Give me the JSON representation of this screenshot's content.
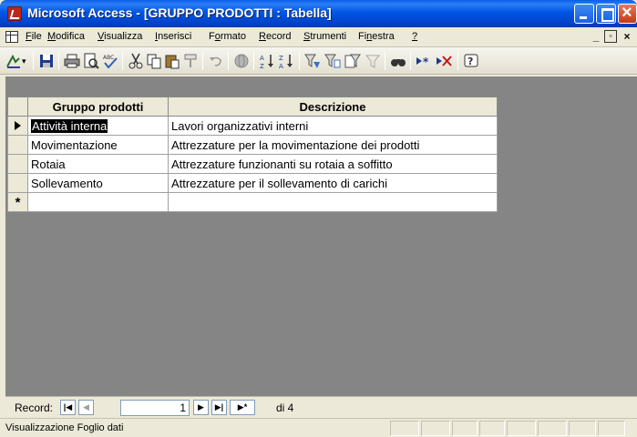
{
  "window": {
    "title": "Microsoft Access - [GRUPPO PRODOTTI : Tabella]"
  },
  "menu": {
    "items": [
      {
        "label": "File",
        "accel": "F"
      },
      {
        "label": "Modifica",
        "accel": "M"
      },
      {
        "label": "Visualizza",
        "accel": "V"
      },
      {
        "label": "Inserisci",
        "accel": "I"
      },
      {
        "label": "Formato",
        "accel": "o"
      },
      {
        "label": "Record",
        "accel": "R"
      },
      {
        "label": "Strumenti",
        "accel": "S"
      },
      {
        "label": "Finestra",
        "accel": "n"
      },
      {
        "label": "?",
        "accel": "?"
      }
    ]
  },
  "toolbar": {
    "icons": [
      "view-design-icon",
      "save-icon",
      "print-icon",
      "print-preview-icon",
      "spelling-icon",
      "cut-icon",
      "copy-icon",
      "paste-icon",
      "format-painter-icon",
      "undo-icon",
      "hyperlink-icon",
      "sort-ascending-icon",
      "sort-descending-icon",
      "filter-by-selection-icon",
      "filter-by-form-icon",
      "apply-filter-icon",
      "remove-filter-icon",
      "find-icon",
      "new-record-icon",
      "delete-record-icon",
      "help-icon"
    ]
  },
  "table": {
    "columns": [
      "Gruppo prodotti",
      "Descrizione"
    ],
    "rows": [
      [
        "Attività interna",
        "Lavori organizzativi interni"
      ],
      [
        "Movimentazione",
        "Attrezzature per la movimentazione dei prodotti"
      ],
      [
        "Rotaia",
        "Attrezzature funzionanti su rotaia a soffitto"
      ],
      [
        "Sollevamento",
        "Attrezzature per il sollevamento di carichi"
      ]
    ],
    "current_row_marker": "▶",
    "new_row_marker": "*"
  },
  "navigator": {
    "label": "Record:",
    "current": "1",
    "of_text": "di 4"
  },
  "status": {
    "text": "Visualizzazione Foglio dati"
  },
  "colors": {
    "titlebar": "#0055e5",
    "datasheet_background": "#858585",
    "chrome": "#ece9d8"
  }
}
